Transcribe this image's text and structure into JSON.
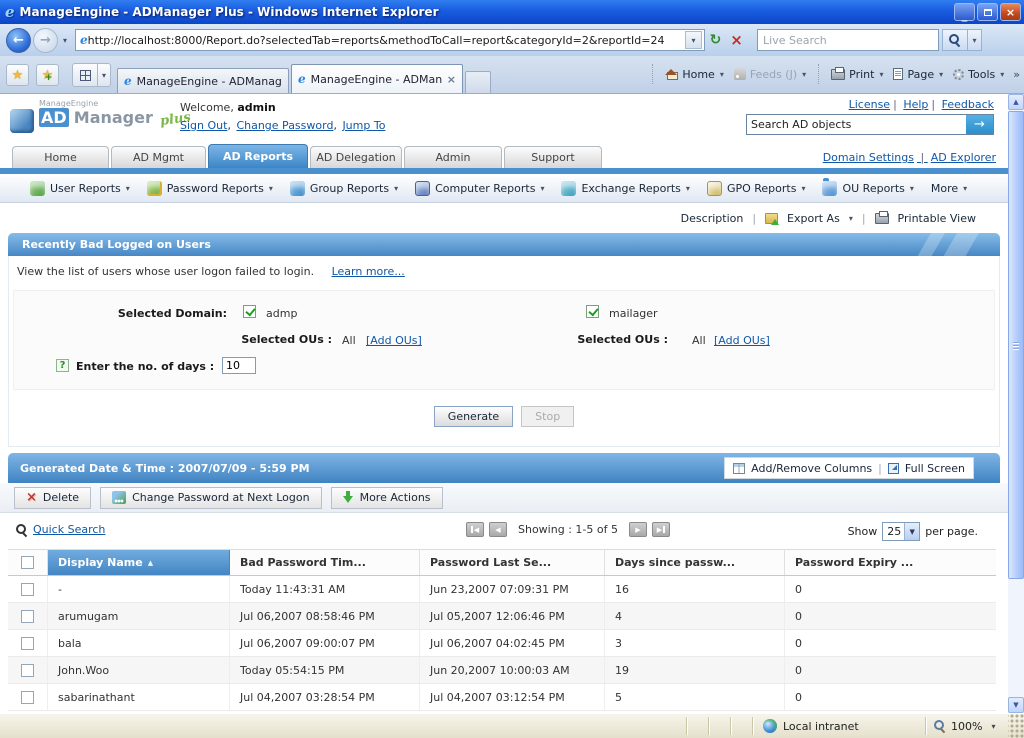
{
  "window": {
    "title": "ManageEngine - ADManager Plus - Windows Internet Explorer",
    "url": "http://localhost:8000/Report.do?selectedTab=reports&methodToCall=report&categoryId=2&reportId=24",
    "live_search": "Live Search",
    "browser_tabs": [
      "ManageEngine - ADManager ...",
      "ManageEngine - ADMana..."
    ],
    "toolbar": {
      "home": "Home",
      "feeds": "Feeds (J)",
      "print": "Print",
      "page": "Page",
      "tools": "Tools"
    },
    "status": {
      "zone": "Local intranet",
      "zoom_level": "100%"
    }
  },
  "header": {
    "brand_small": "ManageEngine",
    "brand_ad": "AD",
    "brand_manager": "Manager",
    "brand_plus": "plus",
    "welcome": "Welcome,",
    "user": "admin",
    "links": [
      "Sign Out",
      "Change Password",
      "Jump To"
    ],
    "top_links": [
      "License",
      "Help",
      "Feedback"
    ],
    "search_value": "Search AD objects",
    "right_links": [
      "Domain Settings",
      "AD Explorer"
    ]
  },
  "nav": {
    "tabs": [
      "Home",
      "AD Mgmt",
      "AD Reports",
      "AD Delegation",
      "Admin",
      "Support"
    ],
    "active": "AD Reports"
  },
  "menus": [
    "User Reports",
    "Password Reports",
    "Group Reports",
    "Computer Reports",
    "Exchange Reports",
    "GPO Reports",
    "OU Reports",
    "More"
  ],
  "page_actions": {
    "description": "Description",
    "export_as": "Export As",
    "printable_view": "Printable View"
  },
  "report": {
    "title": "Recently Bad Logged on Users",
    "description": "View the list of users whose user logon failed to login.",
    "learn_more": "Learn more...",
    "selected_domain_label": "Selected Domain:",
    "selected_ous_label": "Selected OUs :",
    "ou_value": "All",
    "add_ous_link": "[Add OUs]",
    "domains": [
      "admp",
      "mailager"
    ],
    "days_label": "Enter the no. of days :",
    "days_value": "10",
    "generate": "Generate",
    "stop": "Stop"
  },
  "results": {
    "generated_bar": "Generated Date & Time : 2007/07/09 - 5:59 PM",
    "add_remove_columns": "Add/Remove Columns",
    "full_screen": "Full Screen",
    "actions": {
      "delete": "Delete",
      "change_password": "Change Password at Next Logon",
      "more_actions": "More Actions"
    },
    "quick_search": "Quick Search",
    "showing": "Showing : 1-5 of 5",
    "show_label": "Show",
    "page_size": "25",
    "per_page": "per page.",
    "columns": [
      "Display Name",
      "Bad Password Tim...",
      "Password Last Se...",
      "Days since passw...",
      "Password Expiry ..."
    ],
    "rows": [
      {
        "name": "-",
        "bad": "Today 11:43:31 AM",
        "last": "Jun 23,2007 07:09:31 PM",
        "days": "16",
        "expiry": "0"
      },
      {
        "name": "arumugam",
        "bad": "Jul 06,2007 08:58:46 PM",
        "last": "Jul 05,2007 12:06:46 PM",
        "days": "4",
        "expiry": "0"
      },
      {
        "name": "bala",
        "bad": "Jul 06,2007 09:00:07 PM",
        "last": "Jul 06,2007 04:02:45 PM",
        "days": "3",
        "expiry": "0"
      },
      {
        "name": "John.Woo",
        "bad": "Today 05:54:15 PM",
        "last": "Jun 20,2007 10:00:03 AM",
        "days": "19",
        "expiry": "0"
      },
      {
        "name": "sabarinathant",
        "bad": "Jul 04,2007 03:28:54 PM",
        "last": "Jul 04,2007 03:12:54 PM",
        "days": "5",
        "expiry": "0"
      }
    ]
  },
  "colors": {
    "titlebar_blue": "#1a5ce0",
    "accent_blue": "#4a90ce",
    "panel_header_top": "#85bce9",
    "panel_header_bottom": "#4787c4",
    "link_blue": "#1058a7",
    "status_beige": "#ece9d8"
  }
}
